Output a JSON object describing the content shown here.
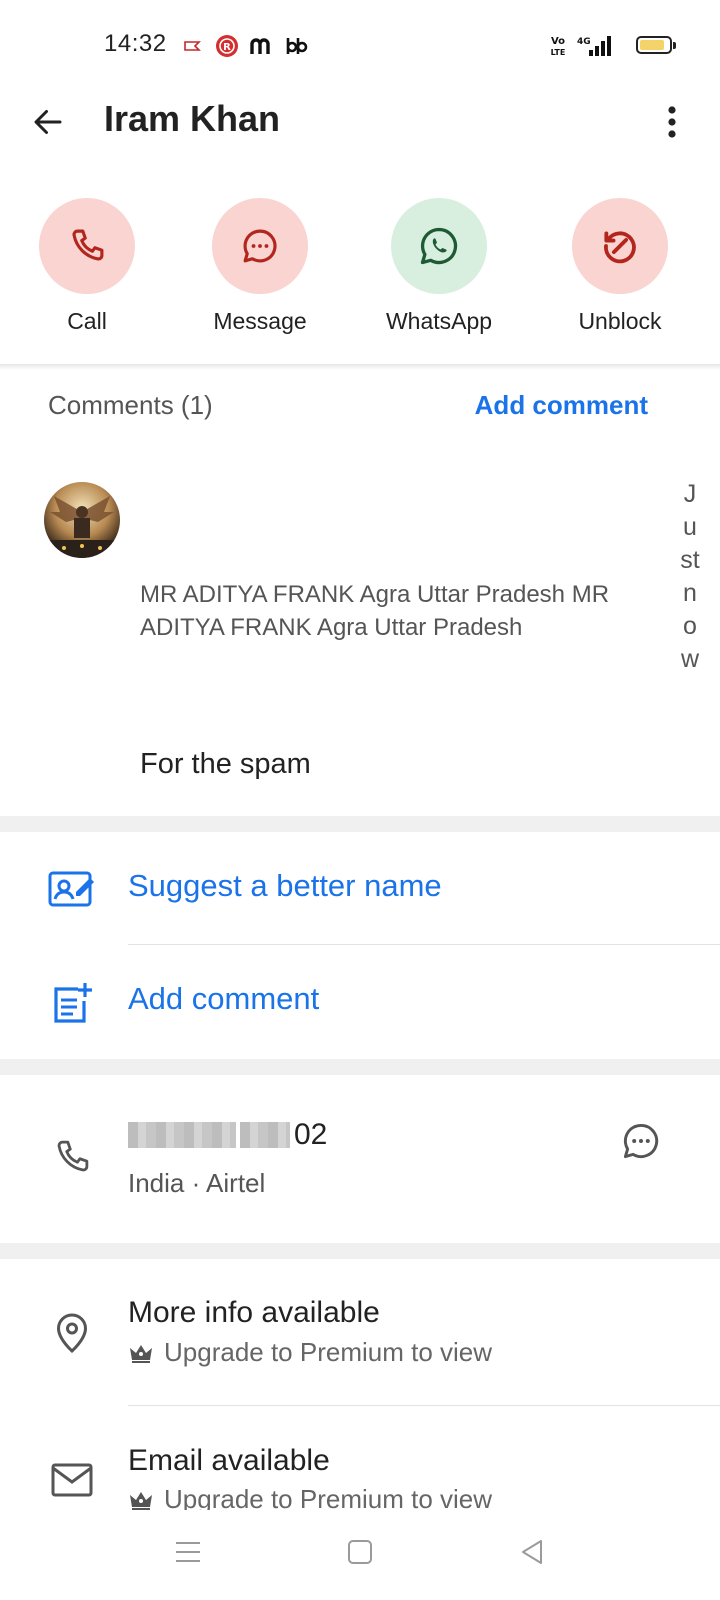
{
  "status_bar": {
    "time": "14:32",
    "icons": [
      "notification-app-icon",
      "jio-icon",
      "m-app-icon",
      "bb-app-icon",
      "volte-icon",
      "4g-signal-icon",
      "battery-icon"
    ]
  },
  "header": {
    "title": "Iram Khan"
  },
  "actions": [
    {
      "label": "Call",
      "icon": "phone-icon",
      "bg": "#f9d4d0",
      "color": "#b3261e"
    },
    {
      "label": "Message",
      "icon": "message-icon",
      "bg": "#f9d4d0",
      "color": "#b3261e"
    },
    {
      "label": "WhatsApp",
      "icon": "whatsapp-icon",
      "bg": "#d8eedf",
      "color": "#1e5b34"
    },
    {
      "label": "Unblock",
      "icon": "unblock-icon",
      "bg": "#f9d4d0",
      "color": "#b3261e"
    }
  ],
  "comments": {
    "title": "Comments (1)",
    "add_label": "Add comment",
    "items": [
      {
        "author": "MR ADITYA FRANK Agra Uttar Pradesh MR ADITYA FRANK Agra Uttar Pradesh",
        "time": "Just now",
        "text": "For the spam"
      }
    ]
  },
  "links": {
    "suggest_name": "Suggest a better name",
    "add_comment": "Add comment"
  },
  "phone": {
    "number_visible_suffix": "02",
    "meta": "India · Airtel"
  },
  "info": {
    "more_info_title": "More info available",
    "more_info_sub": "Upgrade to Premium to view",
    "email_title": "Email available",
    "email_sub": "Upgrade to Premium to view"
  },
  "colors": {
    "accent": "#1a73e8",
    "danger": "#b3261e",
    "whatsapp": "#1e5b34"
  }
}
